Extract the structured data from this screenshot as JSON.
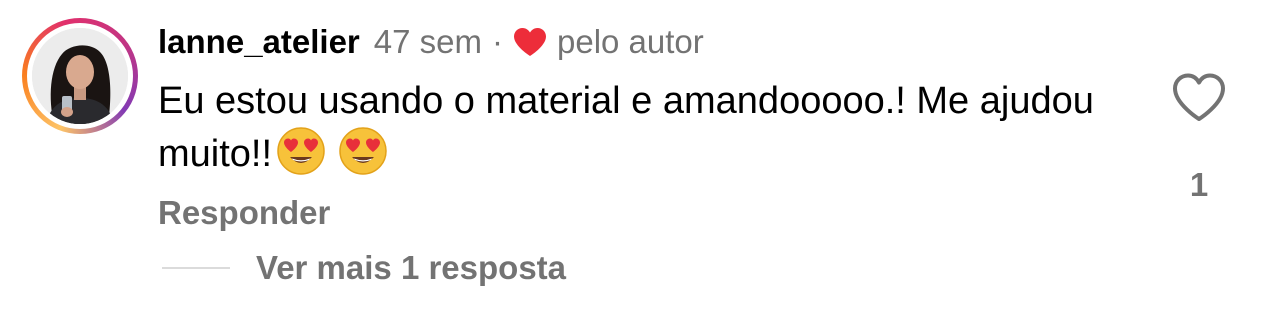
{
  "comment": {
    "username": "lanne_atelier",
    "time_ago": "47 sem",
    "separator": "·",
    "author_liked_label": "pelo autor",
    "text": "Eu estou usando o material e amandooooo.! Me ajudou muito!!",
    "emojis": [
      "heart-eyes-emoji",
      "heart-eyes-emoji"
    ],
    "like_icon": "heart-outline-icon",
    "like_count": "1",
    "reply_label": "Responder",
    "view_replies_label": "Ver mais 1 resposta"
  },
  "colors": {
    "author_heart": "#ed2d3a",
    "secondary_text": "#737373",
    "primary_text": "#000000",
    "divider": "#dbdbdb"
  }
}
